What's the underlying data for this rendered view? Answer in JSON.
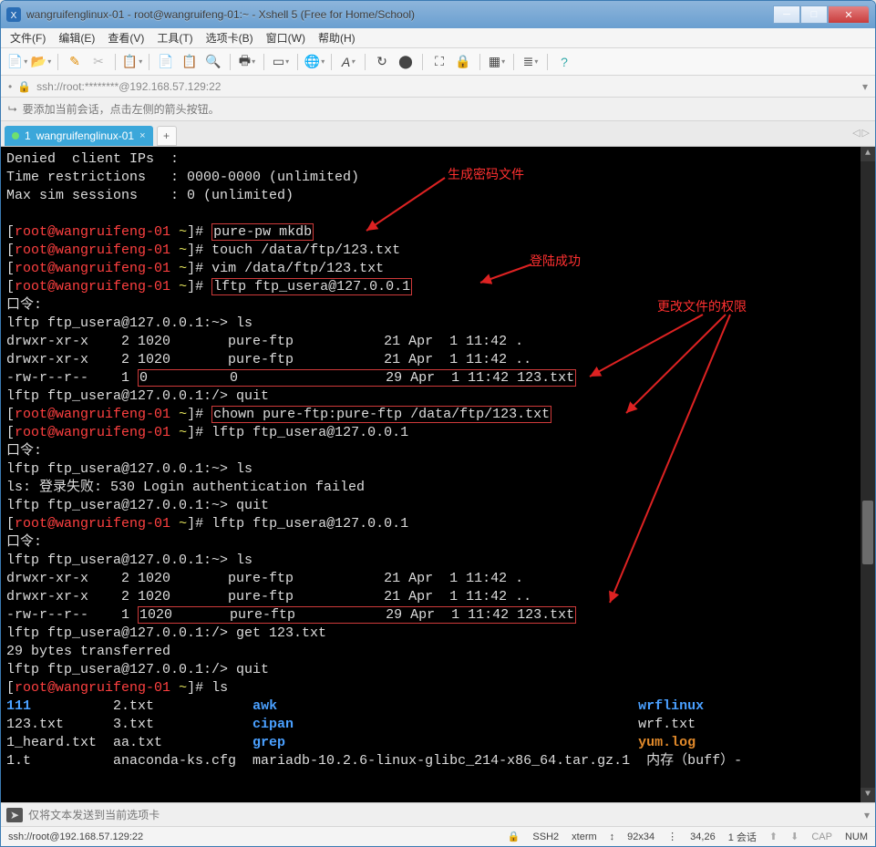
{
  "window": {
    "title": "wangruifenglinux-01 - root@wangruifeng-01:~ - Xshell 5 (Free for Home/School)"
  },
  "menu": {
    "file": "文件(F)",
    "edit": "编辑(E)",
    "view": "查看(V)",
    "tools": "工具(T)",
    "tabs": "选项卡(B)",
    "window": "窗口(W)",
    "help": "帮助(H)"
  },
  "address": {
    "protocol_hint": "ssh://root:********@192.168.57.129:22"
  },
  "hint": {
    "text": "要添加当前会话，点击左侧的箭头按钮。"
  },
  "tab": {
    "index": "1",
    "label": "wangruifenglinux-01"
  },
  "annotations": {
    "genpass": "生成密码文件",
    "loginok": "登陆成功",
    "chperm": "更改文件的权限"
  },
  "terminal": {
    "lines": [
      "Denied  client IPs  :",
      "Time restrictions   : 0000-0000 (unlimited)",
      "Max sim sessions    : 0 (unlimited)",
      "",
      "PROMPT pure-pw mkdb BOX1",
      "PROMPT touch /data/ftp/123.txt",
      "PROMPT vim /data/ftp/123.txt",
      "PROMPT lftp ftp_usera@127.0.0.1 BOX2",
      "口令:",
      "lftp ftp_usera@127.0.0.1:~> ls",
      "drwxr-xr-x    2 1020       pure-ftp           21 Apr  1 11:42 .",
      "drwxr-xr-x    2 1020       pure-ftp           21 Apr  1 11:42 ..",
      "-rw-r--r--    1 0          0                  29 Apr  1 11:42 123.txt BOX3",
      "lftp ftp_usera@127.0.0.1:/> quit",
      "PROMPT chown pure-ftp:pure-ftp /data/ftp/123.txt BOX4",
      "PROMPT lftp ftp_usera@127.0.0.1",
      "口令:",
      "lftp ftp_usera@127.0.0.1:~> ls",
      "ls: 登录失败: 530 Login authentication failed",
      "lftp ftp_usera@127.0.0.1:~> quit",
      "PROMPT lftp ftp_usera@127.0.0.1",
      "口令:",
      "lftp ftp_usera@127.0.0.1:~> ls",
      "drwxr-xr-x    2 1020       pure-ftp           21 Apr  1 11:42 .",
      "drwxr-xr-x    2 1020       pure-ftp           21 Apr  1 11:42 ..",
      "-rw-r--r--    1 1020       pure-ftp           29 Apr  1 11:42 123.txt BOX5",
      "lftp ftp_usera@127.0.0.1:/> get 123.txt",
      "29 bytes transferred",
      "lftp ftp_usera@127.0.0.1:/> quit",
      "PROMPT ls",
      "LSROW 111          2.txt            awk                                            wrflinux",
      "LSROW 123.txt      3.txt            cipan                                          wrf.txt",
      "LSROW 1_heard.txt  aa.txt           grep                                           yum.log",
      "LSROW 1.t          anaconda-ks.cfg  mariadb-10.2.6-linux-glibc_214-x86_64.tar.gz.1  内存（buff）-"
    ],
    "prompt_user": "root@wangruifeng-01",
    "prompt_path": "~",
    "ls_cols": {
      "blue": [
        "111",
        "awk",
        "cipan",
        "grep",
        "wrflinux"
      ],
      "orange": [
        "yum.log"
      ]
    }
  },
  "sendbar": {
    "placeholder": "仅将文本发送到当前选项卡"
  },
  "status": {
    "left": "ssh://root@192.168.57.129:22",
    "ssh": "SSH2",
    "term": "xterm",
    "size": "92x34",
    "cursor": "34,26",
    "sessions": "1 会话",
    "cap": "CAP",
    "num": "NUM"
  }
}
